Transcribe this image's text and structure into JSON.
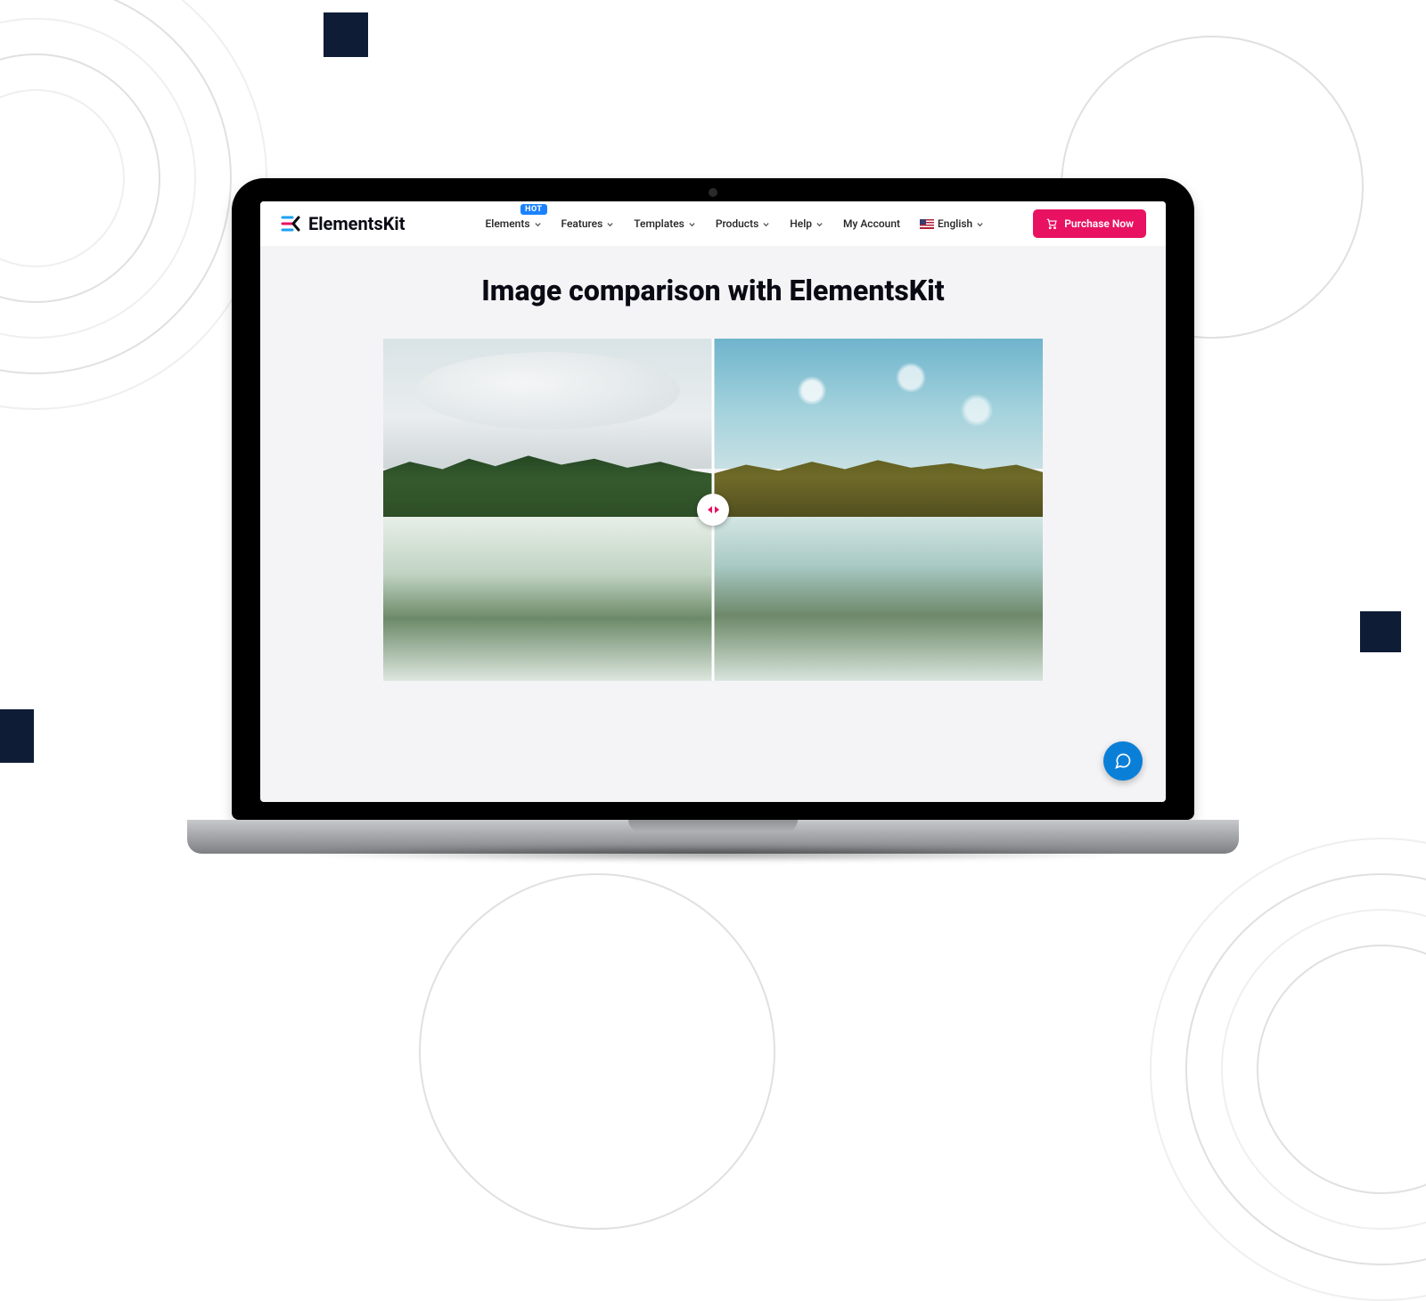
{
  "logo_text": "ElementsKit",
  "nav": {
    "elements": "Elements",
    "elements_badge": "HOT",
    "features": "Features",
    "templates": "Templates",
    "products": "Products",
    "help": "Help",
    "account": "My Account",
    "language": "English"
  },
  "cta_label": "Purchase Now",
  "page_title": "Image comparison with ElementsKit"
}
